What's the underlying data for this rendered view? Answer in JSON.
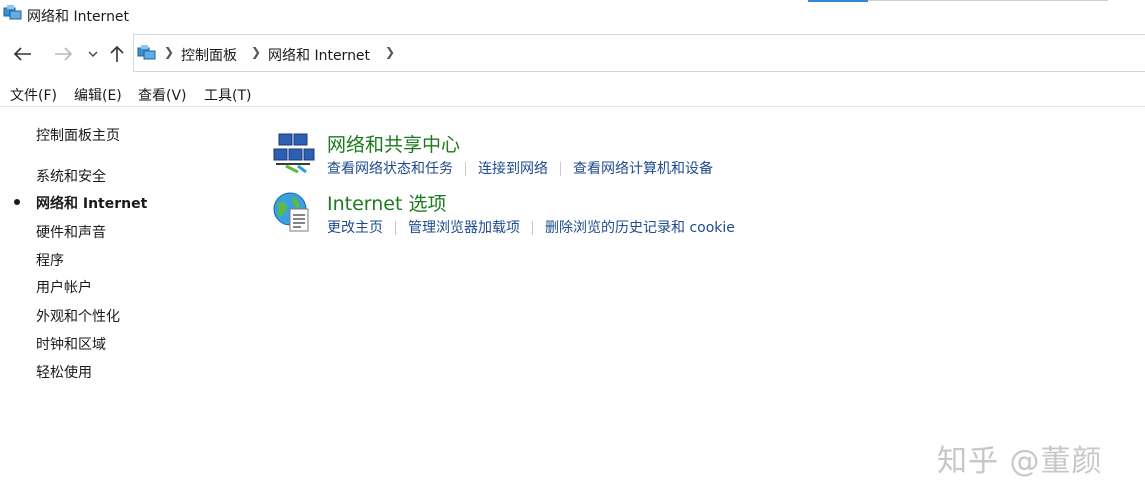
{
  "window": {
    "title": "网络和 Internet"
  },
  "nav": {
    "back_icon": "arrow-left-icon",
    "forward_icon": "arrow-right-icon",
    "recent_icon": "chevron-down-icon",
    "up_icon": "arrow-up-icon"
  },
  "address": {
    "crumbs": [
      "控制面板",
      "网络和 Internet"
    ]
  },
  "menu": [
    "文件(F)",
    "编辑(E)",
    "查看(V)",
    "工具(T)"
  ],
  "sidebar": {
    "home": "控制面板主页",
    "items": [
      {
        "label": "系统和安全",
        "active": false
      },
      {
        "label": "网络和 Internet",
        "active": true
      },
      {
        "label": "硬件和声音",
        "active": false
      },
      {
        "label": "程序",
        "active": false
      },
      {
        "label": "用户帐户",
        "active": false
      },
      {
        "label": "外观和个性化",
        "active": false
      },
      {
        "label": "时钟和区域",
        "active": false
      },
      {
        "label": "轻松使用",
        "active": false
      }
    ]
  },
  "categories": [
    {
      "title": "网络和共享中心",
      "icon": "network-sharing-center-icon",
      "links": [
        "查看网络状态和任务",
        "连接到网络",
        "查看网络计算机和设备"
      ]
    },
    {
      "title": "Internet 选项",
      "icon": "internet-options-globe-icon",
      "links": [
        "更改主页",
        "管理浏览器加载项",
        "删除浏览的历史记录和 cookie"
      ]
    }
  ],
  "watermark": "知乎 @董颜",
  "colors": {
    "category_title": "#1e7a1e",
    "link": "#1e4b8f",
    "accent": "#2f86d6"
  }
}
